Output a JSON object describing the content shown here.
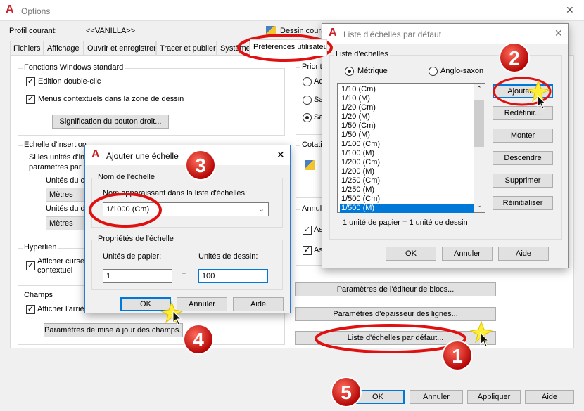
{
  "window": {
    "title": "Options",
    "close": "✕"
  },
  "profile": {
    "label": "Profil courant:",
    "value": "<<VANILLA>>",
    "drawing_label": "Dessin courant:"
  },
  "tabs": [
    "Fichiers",
    "Affichage",
    "Ouvrir et enregistrer",
    "Tracer et publier",
    "Système",
    "Préférences utilisateur"
  ],
  "left": {
    "windows_group": "Fonctions Windows standard",
    "double_click": "Edition double-clic",
    "context_menus": "Menus contextuels dans la zone de dessin",
    "right_button": "Signification du bouton droit...",
    "insert_group": "Echelle d'insertion",
    "insert_text1": "Si les unités d'ins",
    "insert_text2": "paramètres par d",
    "source_units_label": "Unités du co",
    "source_units": "Mètres",
    "target_units_label": "Unités du de",
    "target_units": "Mètres",
    "hyperlink_group": "Hyperlien",
    "hyperlink_check1": "Afficher curseur",
    "hyperlink_check2": "contextuel",
    "fields_group": "Champs",
    "fields_check": "Afficher l'arrière",
    "fields_button": "Paramètres de mise à jour des champs..."
  },
  "right": {
    "priority_group": "Priorité",
    "priority_options": [
      "Ac",
      "Sa",
      "Sa"
    ],
    "dim_group": "Cotatio",
    "undo_group": "Annula",
    "undo_checks": [
      "As",
      "As"
    ],
    "block_editor_button": "Paramètres de l'éditeur de blocs...",
    "lineweight_button": "Paramètres d'épaisseur des lignes...",
    "scale_list_button": "Liste d'échelles par défaut..."
  },
  "footer": {
    "ok": "OK",
    "cancel": "Annuler",
    "apply": "Appliquer",
    "help": "Aide"
  },
  "scale_dialog": {
    "title": "Liste d'échelles par défaut",
    "group": "Liste d'échelles",
    "metric": "Métrique",
    "imperial": "Anglo-saxon",
    "items": [
      "1/10 (Cm)",
      "1/10 (M)",
      "1/20 (Cm)",
      "1/20 (M)",
      "1/50 (Cm)",
      "1/50 (M)",
      "1/100 (Cm)",
      "1/100 (M)",
      "1/200 (Cm)",
      "1/200 (M)",
      "1/250 (Cm)",
      "1/250 (M)",
      "1/500 (Cm)",
      "1/500 (M)"
    ],
    "selected": "1/500 (M)",
    "buttons": [
      "Ajouter...",
      "Redéfinir...",
      "Monter",
      "Descendre",
      "Supprimer",
      "Réinitialiser"
    ],
    "ratio_text": "1 unité de papier = 1 unité de dessin",
    "ok": "OK",
    "cancel": "Annuler",
    "help": "Aide"
  },
  "add_dialog": {
    "title": "Ajouter une échelle",
    "name_group": "Nom de l'échelle",
    "name_label": "Nom apparaissant dans la liste d'échelles:",
    "name_value": "1/1000 (Cm)",
    "props_group": "Propriétés de l'échelle",
    "paper_label": "Unités de papier:",
    "drawing_label": "Unités de dessin:",
    "paper_value": "1",
    "equals": "=",
    "drawing_value": "100",
    "ok": "OK",
    "cancel": "Annuler",
    "help": "Aide"
  },
  "annotations": {
    "steps": [
      "1",
      "2",
      "3",
      "4",
      "5"
    ],
    "color": "#e01010"
  },
  "colors": {
    "accent": "#0078d7",
    "brand": "#c8202a"
  }
}
